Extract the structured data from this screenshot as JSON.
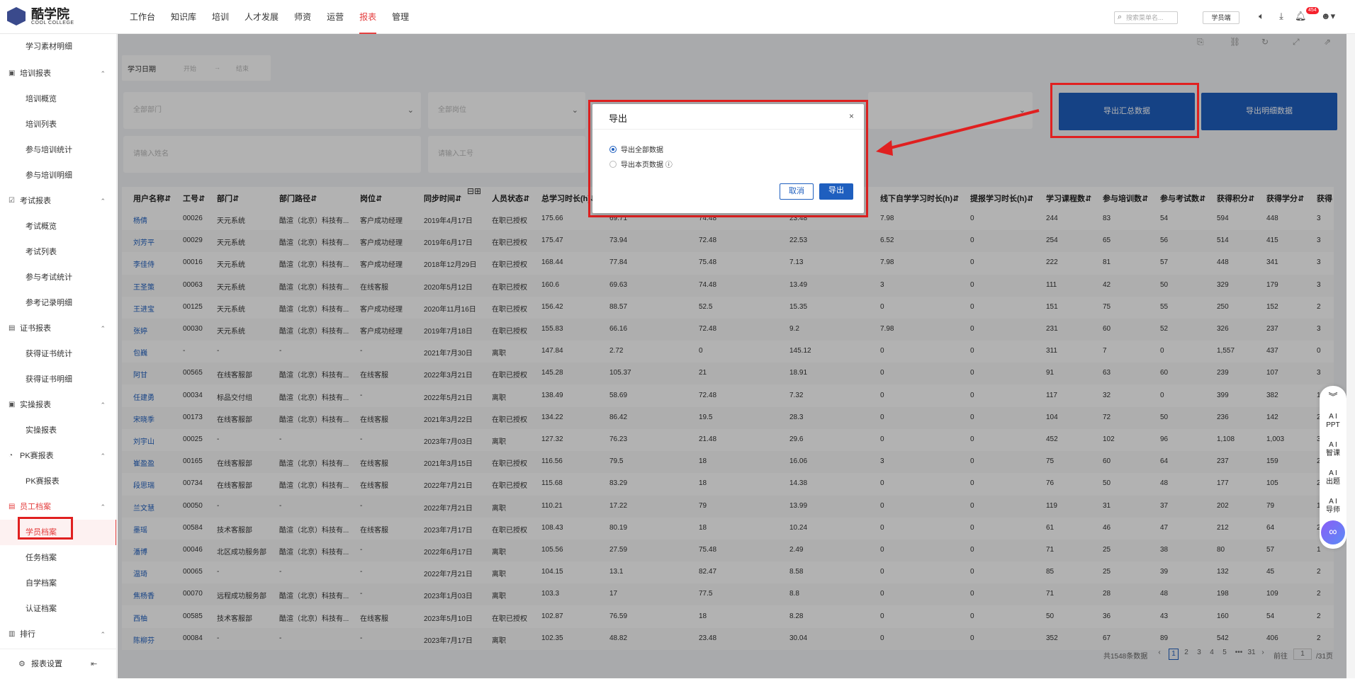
{
  "app": {
    "logo_main": "酷学院",
    "logo_sub": "COOL COLLEGE"
  },
  "nav": [
    "工作台",
    "知识库",
    "培训",
    "人才发展",
    "师资",
    "运营",
    "报表",
    "管理"
  ],
  "topbar": {
    "search_placeholder": "搜索菜单名...",
    "role": "学员端",
    "badge": "454"
  },
  "sidebar": [
    {
      "label": "学习素材明细",
      "type": "sub"
    },
    {
      "label": "培训报表",
      "type": "grp",
      "icon": "▣"
    },
    {
      "label": "培训概览",
      "type": "sub"
    },
    {
      "label": "培训列表",
      "type": "sub"
    },
    {
      "label": "参与培训统计",
      "type": "sub"
    },
    {
      "label": "参与培训明细",
      "type": "sub"
    },
    {
      "label": "考试报表",
      "type": "grp",
      "icon": "☑"
    },
    {
      "label": "考试概览",
      "type": "sub"
    },
    {
      "label": "考试列表",
      "type": "sub"
    },
    {
      "label": "参与考试统计",
      "type": "sub"
    },
    {
      "label": "参考记录明细",
      "type": "sub"
    },
    {
      "label": "证书报表",
      "type": "grp",
      "icon": "▤"
    },
    {
      "label": "获得证书统计",
      "type": "sub"
    },
    {
      "label": "获得证书明细",
      "type": "sub"
    },
    {
      "label": "实操报表",
      "type": "grp",
      "icon": "▣"
    },
    {
      "label": "实操报表",
      "type": "sub"
    },
    {
      "label": "PK赛报表",
      "type": "grp",
      "icon": "◔"
    },
    {
      "label": "PK赛报表",
      "type": "sub"
    },
    {
      "label": "员工档案",
      "type": "grp",
      "icon": "▤",
      "red": true
    },
    {
      "label": "学员档案",
      "type": "sub",
      "active": true
    },
    {
      "label": "任务档案",
      "type": "sub"
    },
    {
      "label": "自学档案",
      "type": "sub"
    },
    {
      "label": "认证档案",
      "type": "sub"
    },
    {
      "label": "排行",
      "type": "grp",
      "icon": "▥"
    }
  ],
  "sidebar_footer": "报表设置",
  "filters": {
    "date_label": "学习日期",
    "date_start": "开始",
    "date_sep": "→",
    "date_end": "结束",
    "dept": "全部部门",
    "post": "全部岗位",
    "name_ph": "请输入姓名",
    "id_ph": "请输入工号"
  },
  "buttons": {
    "export_summary": "导出汇总数据",
    "export_detail": "导出明细数据"
  },
  "table": {
    "headers": [
      "用户名称⇵",
      "工号⇵",
      "部门⇵",
      "部门路径⇵",
      "岗位⇵",
      "同步时间⇵",
      "人员状态⇵",
      "总学习时长(h)⇵",
      "",
      "",
      "",
      "线下自学学习时长(h)⇵",
      "提报学习时长(h)⇵",
      "学习课程数⇵",
      "参与培训数⇵",
      "参与考试数⇵",
      "获得积分⇵",
      "获得学分⇵",
      "获得"
    ],
    "rows": [
      [
        "杨倩",
        "00026",
        "天元系统",
        "酷渲（北京）科技有...",
        "客户成功经理",
        "2019年4月17日",
        "在职已授权",
        "175.66",
        "69.71",
        "74.48",
        "23.48",
        "7.98",
        "0",
        "244",
        "83",
        "54",
        "594",
        "448",
        "3"
      ],
      [
        "刘芳平",
        "00029",
        "天元系统",
        "酷渲（北京）科技有...",
        "客户成功经理",
        "2019年6月17日",
        "在职已授权",
        "175.47",
        "73.94",
        "72.48",
        "22.53",
        "6.52",
        "0",
        "254",
        "65",
        "56",
        "514",
        "415",
        "3"
      ],
      [
        "李佳侍",
        "00016",
        "天元系统",
        "酷渲（北京）科技有...",
        "客户成功经理",
        "2018年12月29日",
        "在职已授权",
        "168.44",
        "77.84",
        "75.48",
        "7.13",
        "7.98",
        "0",
        "222",
        "81",
        "57",
        "448",
        "341",
        "3"
      ],
      [
        "王圣策",
        "00063",
        "天元系统",
        "酷渲（北京）科技有...",
        "在线客服",
        "2020年5月12日",
        "在职已授权",
        "160.6",
        "69.63",
        "74.48",
        "13.49",
        "3",
        "0",
        "111",
        "42",
        "50",
        "329",
        "179",
        "3"
      ],
      [
        "王进宝",
        "00125",
        "天元系统",
        "酷渲（北京）科技有...",
        "客户成功经理",
        "2020年11月16日",
        "在职已授权",
        "156.42",
        "88.57",
        "52.5",
        "15.35",
        "0",
        "0",
        "151",
        "75",
        "55",
        "250",
        "152",
        "2"
      ],
      [
        "张婷",
        "00030",
        "天元系统",
        "酷渲（北京）科技有...",
        "客户成功经理",
        "2019年7月18日",
        "在职已授权",
        "155.83",
        "66.16",
        "72.48",
        "9.2",
        "7.98",
        "0",
        "231",
        "60",
        "52",
        "326",
        "237",
        "3"
      ],
      [
        "包巍",
        "-",
        "-",
        "-",
        "-",
        "2021年7月30日",
        "离职",
        "147.84",
        "2.72",
        "0",
        "145.12",
        "0",
        "0",
        "311",
        "7",
        "0",
        "1,557",
        "437",
        "0"
      ],
      [
        "阿甘",
        "00565",
        "在线客服部",
        "酷渲（北京）科技有...",
        "在线客服",
        "2022年3月21日",
        "在职已授权",
        "145.28",
        "105.37",
        "21",
        "18.91",
        "0",
        "0",
        "91",
        "63",
        "60",
        "239",
        "107",
        "3"
      ],
      [
        "任建勇",
        "00034",
        "标品交付组",
        "酷渲（北京）科技有...",
        "-",
        "2022年5月21日",
        "离职",
        "138.49",
        "58.69",
        "72.48",
        "7.32",
        "0",
        "0",
        "117",
        "32",
        "0",
        "399",
        "382",
        "1"
      ],
      [
        "宋晓季",
        "00173",
        "在线客服部",
        "酷渲（北京）科技有...",
        "在线客服",
        "2021年3月22日",
        "在职已授权",
        "134.22",
        "86.42",
        "19.5",
        "28.3",
        "0",
        "0",
        "104",
        "72",
        "50",
        "236",
        "142",
        "2"
      ],
      [
        "刘宇山",
        "00025",
        "-",
        "-",
        "-",
        "2023年7月03日",
        "离职",
        "127.32",
        "76.23",
        "21.48",
        "29.6",
        "0",
        "0",
        "452",
        "102",
        "96",
        "1,108",
        "1,003",
        "3"
      ],
      [
        "崔盈盈",
        "00165",
        "在线客服部",
        "酷渲（北京）科技有...",
        "在线客服",
        "2021年3月15日",
        "在职已授权",
        "116.56",
        "79.5",
        "18",
        "16.06",
        "3",
        "0",
        "75",
        "60",
        "64",
        "237",
        "159",
        "2"
      ],
      [
        "段思瑞",
        "00734",
        "在线客服部",
        "酷渲（北京）科技有...",
        "在线客服",
        "2022年7月21日",
        "在职已授权",
        "115.68",
        "83.29",
        "18",
        "14.38",
        "0",
        "0",
        "76",
        "50",
        "48",
        "177",
        "105",
        "2"
      ],
      [
        "兰文慧",
        "00050",
        "-",
        "-",
        "-",
        "2022年7月21日",
        "离职",
        "110.21",
        "17.22",
        "79",
        "13.99",
        "0",
        "0",
        "119",
        "31",
        "37",
        "202",
        "79",
        "1"
      ],
      [
        "墨瑶",
        "00584",
        "技术客服部",
        "酷渲（北京）科技有...",
        "在线客服",
        "2023年7月17日",
        "在职已授权",
        "108.43",
        "80.19",
        "18",
        "10.24",
        "0",
        "0",
        "61",
        "46",
        "47",
        "212",
        "64",
        "2"
      ],
      [
        "潘博",
        "00046",
        "北区成功服务部",
        "酷渲（北京）科技有...",
        "-",
        "2022年6月17日",
        "离职",
        "105.56",
        "27.59",
        "75.48",
        "2.49",
        "0",
        "0",
        "71",
        "25",
        "38",
        "80",
        "57",
        "1"
      ],
      [
        "温琦",
        "00065",
        "-",
        "-",
        "-",
        "2022年7月21日",
        "离职",
        "104.15",
        "13.1",
        "82.47",
        "8.58",
        "0",
        "0",
        "85",
        "25",
        "39",
        "132",
        "45",
        "2"
      ],
      [
        "焦杨香",
        "00070",
        "远程成功服务部",
        "酷渲（北京）科技有...",
        "-",
        "2023年1月03日",
        "离职",
        "103.3",
        "17",
        "77.5",
        "8.8",
        "0",
        "0",
        "71",
        "28",
        "48",
        "198",
        "109",
        "2"
      ],
      [
        "西柚",
        "00585",
        "技术客服部",
        "酷渲（北京）科技有...",
        "在线客服",
        "2023年5月10日",
        "在职已授权",
        "102.87",
        "76.59",
        "18",
        "8.28",
        "0",
        "0",
        "50",
        "36",
        "43",
        "160",
        "54",
        "2"
      ],
      [
        "陈柳芬",
        "00084",
        "-",
        "-",
        "-",
        "2023年7月17日",
        "离职",
        "102.35",
        "48.82",
        "23.48",
        "30.04",
        "0",
        "0",
        "352",
        "67",
        "89",
        "542",
        "406",
        "2"
      ]
    ]
  },
  "pagination": {
    "total": "共1548条数据",
    "pages": [
      "1",
      "2",
      "3",
      "4",
      "5",
      "•••",
      "31"
    ],
    "goto": "前往",
    "page_input": "1",
    "total_pages": "/31页"
  },
  "dialog": {
    "title": "导出",
    "close": "×",
    "opt1": "导出全部数据",
    "opt2": "导出本页数据 ⓘ",
    "cancel": "取消",
    "ok": "导出"
  },
  "ai_panel": [
    "A I\nPPT",
    "A I\n智课",
    "A I\n出题",
    "A I\n导师"
  ],
  "colors": {
    "accent": "#e43f3f",
    "primary": "#1f5fbf",
    "highlight": "#e02020"
  }
}
